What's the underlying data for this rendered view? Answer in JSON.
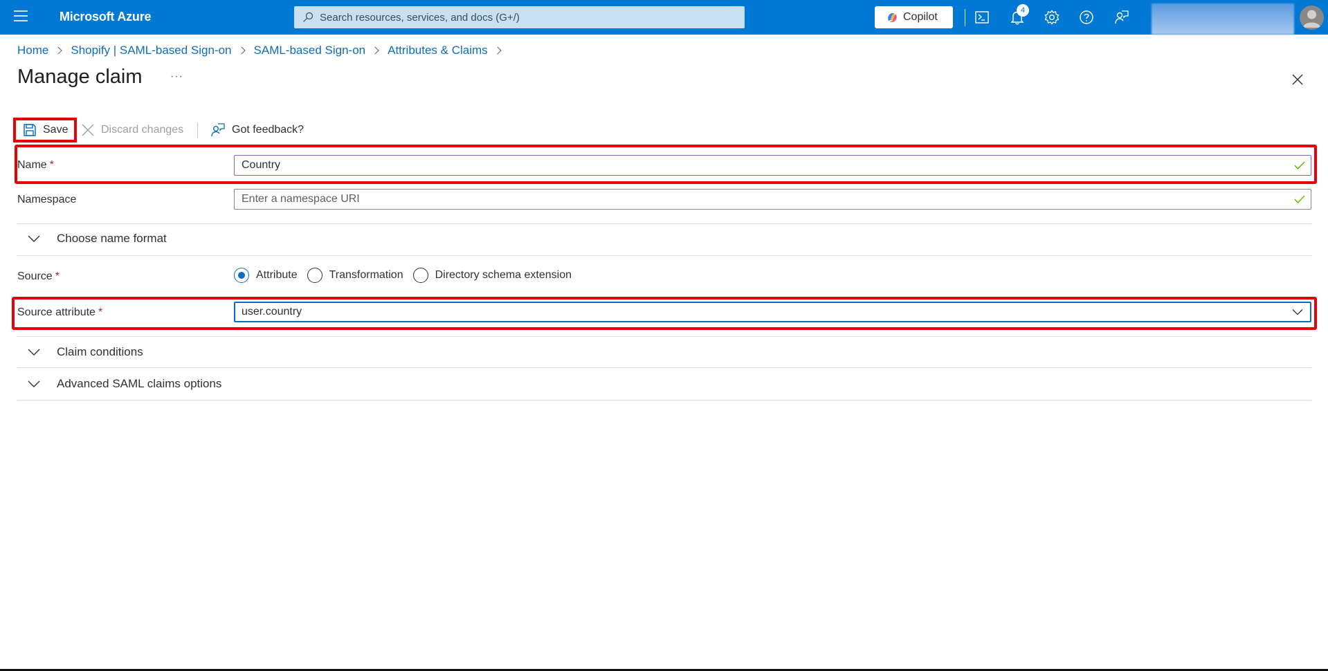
{
  "topbar": {
    "brand": "Microsoft Azure",
    "search_placeholder": "Search resources, services, and docs (G+/)",
    "copilot_label": "Copilot",
    "notification_count": "4",
    "icons": [
      "cloud-shell-icon",
      "notifications-icon",
      "settings-icon",
      "help-icon",
      "feedback-icon"
    ],
    "accent_color": "#0078d4"
  },
  "breadcrumb": [
    {
      "label": "Home"
    },
    {
      "label": "Shopify | SAML-based Sign-on"
    },
    {
      "label": "SAML-based Sign-on"
    },
    {
      "label": "Attributes & Claims"
    }
  ],
  "page": {
    "title": "Manage claim",
    "more_label": "···"
  },
  "toolbar": {
    "save_label": "Save",
    "discard_label": "Discard changes",
    "feedback_label": "Got feedback?"
  },
  "form": {
    "name": {
      "label": "Name",
      "required": "*",
      "value": "Country"
    },
    "namespace": {
      "label": "Namespace",
      "value": "",
      "placeholder": "Enter a namespace URI"
    },
    "choose_name_format": "Choose name format",
    "source": {
      "label": "Source",
      "required": "*",
      "options": [
        {
          "label": "Attribute",
          "checked": true
        },
        {
          "label": "Transformation",
          "checked": false
        },
        {
          "label": "Directory schema extension",
          "checked": false
        }
      ]
    },
    "source_attribute": {
      "label": "Source attribute",
      "required": "*",
      "value": "user.country"
    },
    "claim_conditions": "Claim conditions",
    "advanced_options": "Advanced SAML claims options"
  },
  "highlight_color": "#e8000b"
}
